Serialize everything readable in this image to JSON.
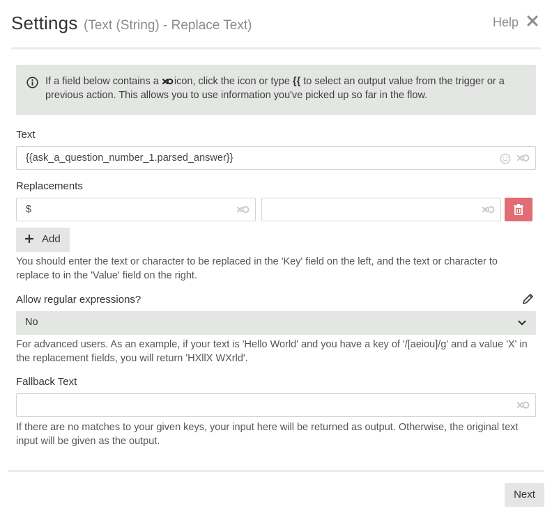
{
  "header": {
    "title": "Settings",
    "subtitle": "(Text (String) - Replace Text)",
    "help_label": "Help",
    "close_icon": "close-icon"
  },
  "info": {
    "icon": "info-icon",
    "text_before": "If a field below contains a",
    "text_middle": "icon, click the icon or type",
    "braces": "{{",
    "text_after": "to select an output value from the trigger or a previous action. This allows you to use information you've picked up so far in the flow."
  },
  "text_field": {
    "label": "Text",
    "value": "{{ask_a_question_number_1.parsed_answer}}",
    "icons": [
      "emoji-icon",
      "link-icon"
    ]
  },
  "replacements": {
    "label": "Replacements",
    "rows": [
      {
        "key": "$",
        "value": ""
      }
    ],
    "add_label": "Add",
    "help": "You should enter the text or character to be replaced in the 'Key' field on the left, and the text or character to replace to in the 'Value' field on the right."
  },
  "regex": {
    "label": "Allow regular expressions?",
    "selected": "No",
    "help": "For advanced users. As an example, if your text is 'Hello World' and you have a key of '/[aeiou]/g' and a value 'X' in the replacement fields, you will return 'HXllX WXrld'."
  },
  "fallback": {
    "label": "Fallback Text",
    "value": "",
    "help": "If there are no matches to your given keys, your input here will be returned as output. Otherwise, the original text input will be given as the output."
  },
  "footer": {
    "next_label": "Next"
  },
  "colors": {
    "panel_gray": "#e4e6e4",
    "delete_red": "#e36b73",
    "border": "#d4d4d4",
    "muted_text": "#8a8a8a"
  }
}
